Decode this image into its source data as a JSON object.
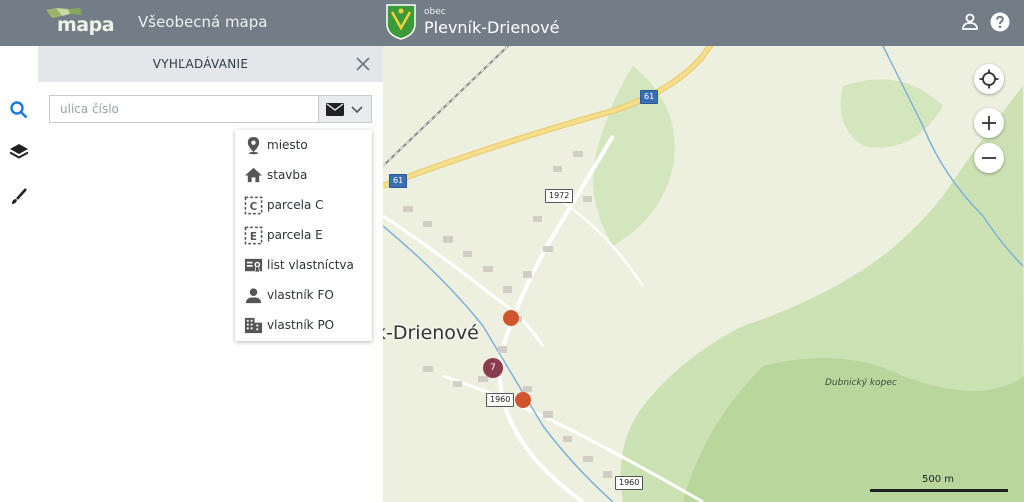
{
  "header": {
    "logo_text": "mapa",
    "app_title": "Všeobecná mapa",
    "obec_small": "obec",
    "obec_name": "Plevník-Drienové"
  },
  "panel": {
    "title": "VYHĽADÁVANIE"
  },
  "search": {
    "placeholder": "ulica číslo"
  },
  "dropdown": {
    "items": [
      {
        "label": "miesto",
        "icon": "map-pin-icon"
      },
      {
        "label": "stavba",
        "icon": "house-icon"
      },
      {
        "label": "parcela C",
        "icon": "parcel-c-icon"
      },
      {
        "label": "parcela E",
        "icon": "parcel-e-icon"
      },
      {
        "label": "list vlastníctva",
        "icon": "ownership-sheet-icon"
      },
      {
        "label": "vlastník FO",
        "icon": "person-icon"
      },
      {
        "label": "vlastník PO",
        "icon": "building-icon"
      }
    ]
  },
  "map": {
    "place_label": "k-Drienové",
    "hill_label": "Dubnický kopec",
    "road_61": "61",
    "road_1972": "1972",
    "road_1960": "1960",
    "poi_number": "7",
    "scale": "500 m"
  }
}
